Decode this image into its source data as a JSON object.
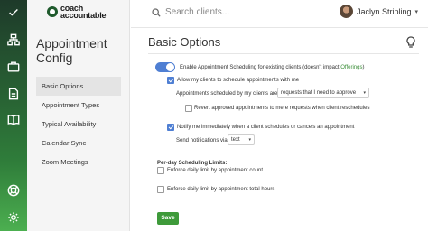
{
  "brand": {
    "line1": "coach",
    "line2": "accountable"
  },
  "search": {
    "placeholder": "Search clients..."
  },
  "user": {
    "name": "Jaclyn Stripling"
  },
  "sidebar": {
    "title_line1": "Appointment",
    "title_line2": "Config",
    "items": [
      {
        "label": "Basic Options"
      },
      {
        "label": "Appointment Types"
      },
      {
        "label": "Typical Availability"
      },
      {
        "label": "Calendar Sync"
      },
      {
        "label": "Zoom Meetings"
      }
    ]
  },
  "main": {
    "title": "Basic Options",
    "enable_label": "Enable Appointment Scheduling for existing clients (doesn't impact ",
    "enable_link": "Offerings",
    "enable_suffix": ")",
    "allow_label": "Allow my clients to schedule appointments with me",
    "scheduled_by_label": "Appointments scheduled by my clients are",
    "scheduled_by_value": "requests that I need to approve",
    "revert_label": "Revert approved appointments to mere requests when client reschedules",
    "notify_label": "Notify me immediately when a client schedules or cancels an appointment",
    "send_via_label": "Send notifications via",
    "send_via_value": "text",
    "per_day_heading": "Per-day Scheduling Limits:",
    "limit_count_label": "Enforce daily limit by appointment count",
    "limit_hours_label": "Enforce daily limit by appointment total hours",
    "save_label": "Save"
  },
  "state": {
    "enable_toggle": true,
    "allow_checked": true,
    "revert_checked": false,
    "notify_checked": true,
    "limit_count_checked": false,
    "limit_hours_checked": false
  },
  "colors": {
    "accent": "#4f7fd3",
    "brand_green": "#3e9a3a"
  },
  "icons": [
    "check-icon",
    "org-chart-icon",
    "briefcase-icon",
    "document-icon",
    "book-icon",
    "lifebuoy-icon",
    "gear-icon",
    "search-icon",
    "lightbulb-icon"
  ]
}
